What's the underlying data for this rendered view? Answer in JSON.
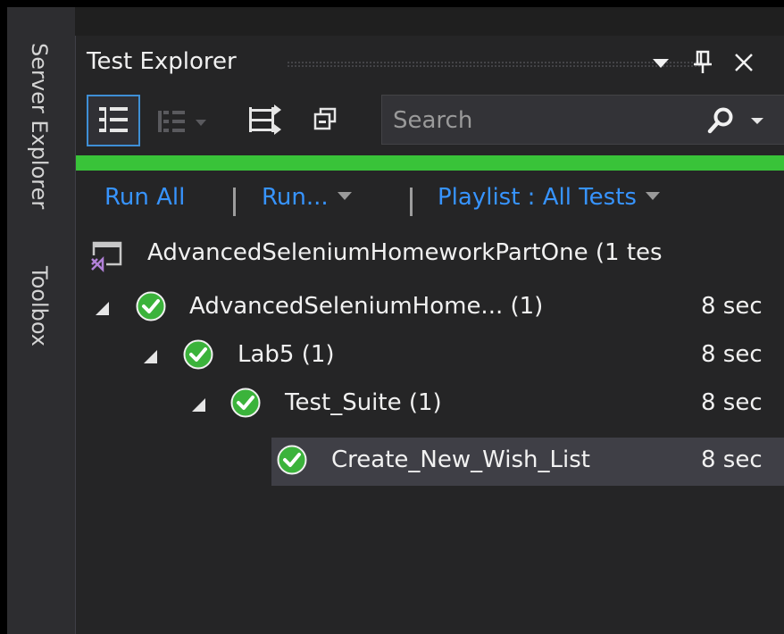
{
  "side_tabs": {
    "server_explorer": "Server Explorer",
    "toolbox": "Toolbox"
  },
  "panel": {
    "title": "Test Explorer",
    "buttons": {
      "dropdown": "▾",
      "pin": "ဂ",
      "close": "✕"
    }
  },
  "toolbar": {
    "group_by_icon": "group-by-icon",
    "hierarchy_icon": "hierarchy-icon",
    "playlist_icon": "playlist-icon",
    "collapse_icon": "collapse-all-icon",
    "search": {
      "placeholder": "Search",
      "value": ""
    }
  },
  "progress": {
    "fraction": 1.0,
    "color": "#39c339"
  },
  "command_bar": {
    "run_all": "Run All",
    "run": "Run...",
    "playlist": "Playlist : All Tests"
  },
  "tree": {
    "project": {
      "label": "AdvancedSeleniumHomeworkPartOne (1 tes"
    },
    "nodes": [
      {
        "label": "AdvancedSeleniumHome... (1)",
        "duration": "8 sec"
      },
      {
        "label": "Lab5 (1)",
        "duration": "8 sec"
      },
      {
        "label": "Test_Suite (1)",
        "duration": "8 sec"
      },
      {
        "label": "Create_New_Wish_List",
        "duration": "8 sec"
      }
    ]
  },
  "colors": {
    "accent": "#3794ff",
    "pass": "#3bb33b",
    "panel_bg": "#252526"
  }
}
